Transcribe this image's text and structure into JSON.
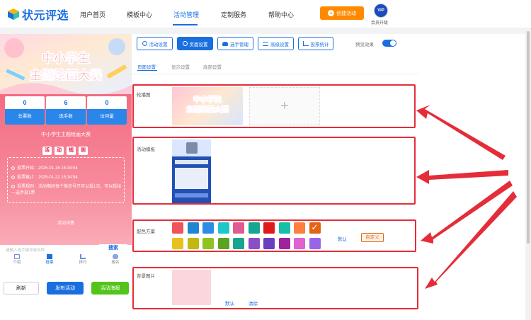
{
  "brand": {
    "name": "状元评选"
  },
  "nav": {
    "items": [
      "用户首页",
      "模板中心",
      "活动管理",
      "定制服务",
      "帮助中心"
    ],
    "active_index": 2
  },
  "create_button": "创建活动",
  "vip": {
    "badge": "VIP",
    "label": "会员升级"
  },
  "preview": {
    "banner_line1": "中小学生",
    "banner_line2": "主题绘画大赛",
    "stats": [
      {
        "value": "0",
        "label": "总票数"
      },
      {
        "value": "6",
        "label": "选手数"
      },
      {
        "value": "0",
        "label": "访问量"
      }
    ],
    "activity_name": "中小学生主题绘画大赛",
    "rules_chars": [
      "活",
      "动",
      "规",
      "则"
    ],
    "rules": [
      "投票开始：2025-01-16 15:34:54",
      "投票截止：2025-01-22 15:34:54",
      "投票规则：活动期间每个微信号只可以投1次，可以投给一选手投1票"
    ],
    "more_text": "活动详情",
    "search_placeholder": "请输入选手编号或名称",
    "search_button": "搜索",
    "tabbar": [
      "介绍",
      "投票",
      "排行",
      "报名"
    ]
  },
  "bottom_buttons": {
    "refresh": "刷新",
    "publish": "发布活动",
    "poster": "活动海报"
  },
  "toolbar": {
    "buttons": [
      "活动设置",
      "页面设置",
      "选手管理",
      "高级设置",
      "投票统计"
    ],
    "active_index": 1,
    "preview_label": "预览效果",
    "preview_on": true
  },
  "subtabs": {
    "items": [
      "页面设置",
      "显示设置",
      "底部设置"
    ],
    "active_index": 0
  },
  "sections": {
    "carousel": {
      "label": "轮播图",
      "thumb_line1": "中小学生",
      "thumb_line2": "主题绘画大赛"
    },
    "template": {
      "label": "活动模板"
    },
    "color": {
      "label": "配色方案",
      "row1": [
        "#f0545b",
        "#1f86cf",
        "#2b8de6",
        "#1cc9c9",
        "#e05b8f",
        "#17a58f",
        "#e0191b",
        "#16c0a8",
        "#ff7f3e",
        "#e36514"
      ],
      "row2": [
        "#e8c21a",
        "#c3b80f",
        "#8fc31f",
        "#5aa41f",
        "#16a58f",
        "#8a4ec7",
        "#6b3dbf",
        "#a0229c",
        "#e061cf",
        "#9a64e8"
      ],
      "selected_index": 9,
      "default_label": "默认",
      "custom_label": "自定义"
    },
    "background": {
      "label": "背景图片",
      "default_label": "默认",
      "clear_label": "清除"
    }
  },
  "colors": {
    "primary": "#1a6fe0",
    "orange": "#ff8a00",
    "green": "#52c41a",
    "annotation_red": "#e52d3a"
  }
}
